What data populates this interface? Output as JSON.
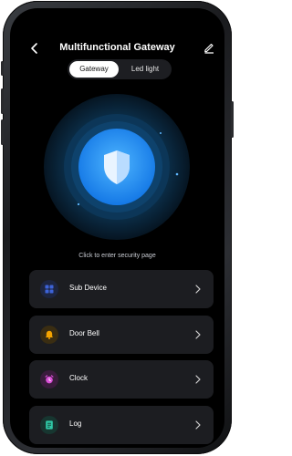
{
  "header": {
    "title": "Multifunctional Gateway"
  },
  "tabs": [
    {
      "label": "Gateway",
      "active": true
    },
    {
      "label": "Led light",
      "active": false
    }
  ],
  "security": {
    "hint": "Click to enter security page",
    "icon": "shield-icon"
  },
  "menu": [
    {
      "label": "Sub Device",
      "icon": "grid-icon",
      "icon_color": "#3d63d8",
      "icon_bg": "#1d2540"
    },
    {
      "label": "Door Bell",
      "icon": "bell-icon",
      "icon_color": "#f4a300",
      "icon_bg": "#3a2d12"
    },
    {
      "label": "Clock",
      "icon": "alarm-clock-icon",
      "icon_color": "#d94fd6",
      "icon_bg": "#3a1c3c"
    },
    {
      "label": "Log",
      "icon": "log-icon",
      "icon_color": "#2fc9a6",
      "icon_bg": "#173630"
    }
  ],
  "colors": {
    "background": "#000000",
    "card": "#1c1d21",
    "accent": "#1e8cff"
  }
}
